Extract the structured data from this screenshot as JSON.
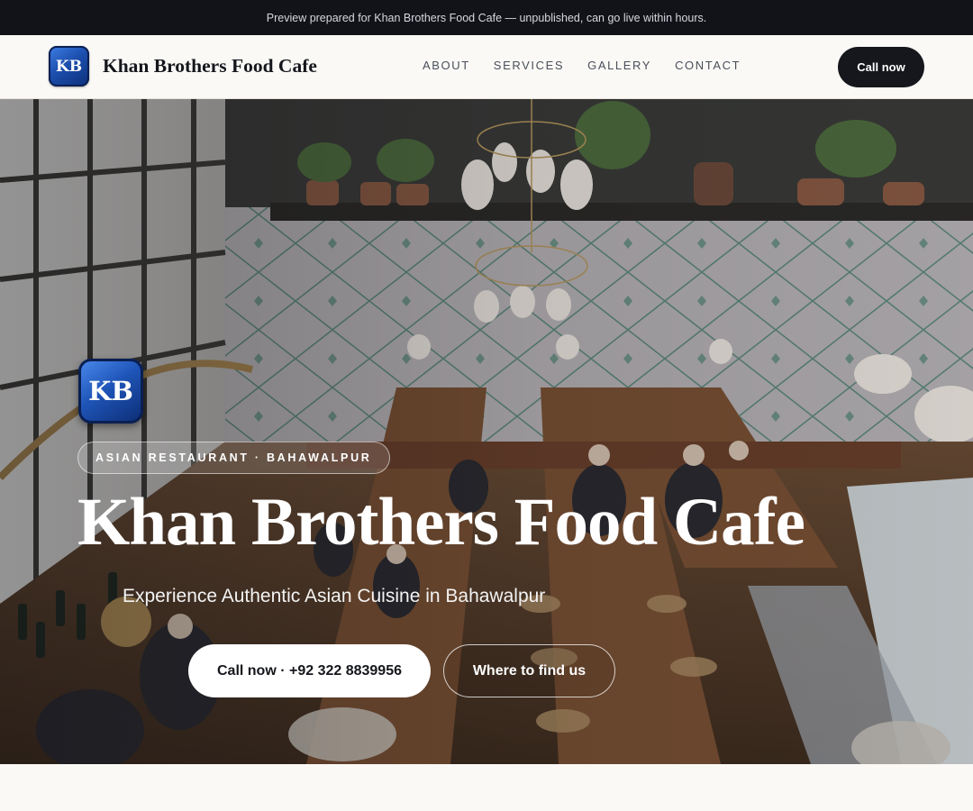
{
  "preview_bar": {
    "text": "Preview prepared for Khan Brothers Food Cafe — unpublished, can go live within hours."
  },
  "header": {
    "logo_text": "KB",
    "brand_name": "Khan Brothers Food Cafe",
    "nav": [
      {
        "label": "ABOUT"
      },
      {
        "label": "SERVICES"
      },
      {
        "label": "GALLERY"
      },
      {
        "label": "CONTACT"
      }
    ],
    "call_button": "Call now"
  },
  "hero": {
    "logo_text": "KB",
    "category": "ASIAN RESTAURANT · BAHAWALPUR",
    "title": "Khan Brothers Food Cafe",
    "subtitle": "Experience Authentic Asian Cuisine in Bahawalpur",
    "primary_button": "Call now · +92 322 8839956",
    "secondary_button": "Where to find us"
  },
  "colors": {
    "dark": "#15171c",
    "preview_bar_bg": "#111318",
    "page_bg": "#faf9f6",
    "logo_blue": "#1f55b8",
    "nav_text": "#4a4f59"
  }
}
